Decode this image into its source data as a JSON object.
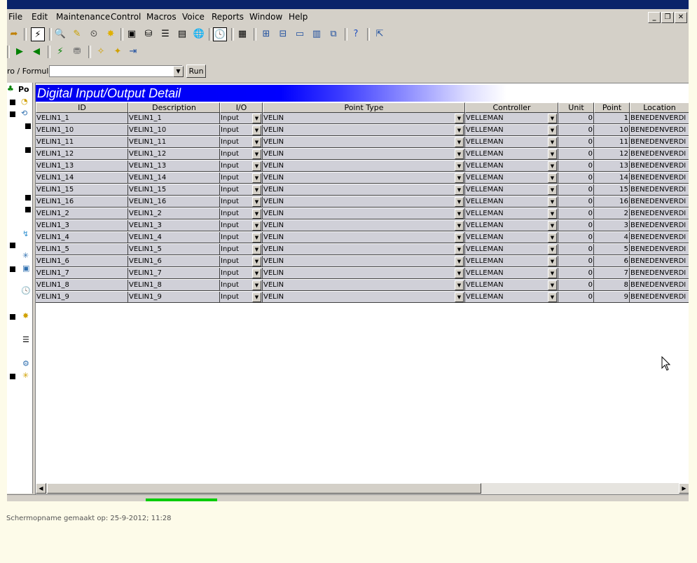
{
  "app": {
    "window_title": ""
  },
  "menu": [
    "File",
    "Edit",
    "Maintenance",
    "Control",
    "Macros",
    "Voice",
    "Reports",
    "Window",
    "Help"
  ],
  "macro": {
    "label": "ro / Formula:",
    "value": "",
    "run_label": "Run"
  },
  "tree": {
    "root_label": "Po"
  },
  "detail": {
    "title": "Digital Input/Output Detail"
  },
  "columns": [
    "ID",
    "Description",
    "I/O",
    "Point Type",
    "Controller",
    "Unit",
    "Point",
    "Location"
  ],
  "rows": [
    {
      "id": "VELIN1_1",
      "desc": "VELIN1_1",
      "io": "Input",
      "type": "VELIN",
      "ctrl": "VELLEMAN",
      "unit": "0",
      "point": "1",
      "loc": "BENEDENVERDI"
    },
    {
      "id": "VELIN1_10",
      "desc": "VELIN1_10",
      "io": "Input",
      "type": "VELIN",
      "ctrl": "VELLEMAN",
      "unit": "0",
      "point": "10",
      "loc": "BENEDENVERDI"
    },
    {
      "id": "VELIN1_11",
      "desc": "VELIN1_11",
      "io": "Input",
      "type": "VELIN",
      "ctrl": "VELLEMAN",
      "unit": "0",
      "point": "11",
      "loc": "BENEDENVERDI"
    },
    {
      "id": "VELIN1_12",
      "desc": "VELIN1_12",
      "io": "Input",
      "type": "VELIN",
      "ctrl": "VELLEMAN",
      "unit": "0",
      "point": "12",
      "loc": "BENEDENVERDI"
    },
    {
      "id": "VELIN1_13",
      "desc": "VELIN1_13",
      "io": "Input",
      "type": "VELIN",
      "ctrl": "VELLEMAN",
      "unit": "0",
      "point": "13",
      "loc": "BENEDENVERDI"
    },
    {
      "id": "VELIN1_14",
      "desc": "VELIN1_14",
      "io": "Input",
      "type": "VELIN",
      "ctrl": "VELLEMAN",
      "unit": "0",
      "point": "14",
      "loc": "BENEDENVERDI"
    },
    {
      "id": "VELIN1_15",
      "desc": "VELIN1_15",
      "io": "Input",
      "type": "VELIN",
      "ctrl": "VELLEMAN",
      "unit": "0",
      "point": "15",
      "loc": "BENEDENVERDI"
    },
    {
      "id": "VELIN1_16",
      "desc": "VELIN1_16",
      "io": "Input",
      "type": "VELIN",
      "ctrl": "VELLEMAN",
      "unit": "0",
      "point": "16",
      "loc": "BENEDENVERDI"
    },
    {
      "id": "VELIN1_2",
      "desc": "VELIN1_2",
      "io": "Input",
      "type": "VELIN",
      "ctrl": "VELLEMAN",
      "unit": "0",
      "point": "2",
      "loc": "BENEDENVERDI"
    },
    {
      "id": "VELIN1_3",
      "desc": "VELIN1_3",
      "io": "Input",
      "type": "VELIN",
      "ctrl": "VELLEMAN",
      "unit": "0",
      "point": "3",
      "loc": "BENEDENVERDI"
    },
    {
      "id": "VELIN1_4",
      "desc": "VELIN1_4",
      "io": "Input",
      "type": "VELIN",
      "ctrl": "VELLEMAN",
      "unit": "0",
      "point": "4",
      "loc": "BENEDENVERDI"
    },
    {
      "id": "VELIN1_5",
      "desc": "VELIN1_5",
      "io": "Input",
      "type": "VELIN",
      "ctrl": "VELLEMAN",
      "unit": "0",
      "point": "5",
      "loc": "BENEDENVERDI"
    },
    {
      "id": "VELIN1_6",
      "desc": "VELIN1_6",
      "io": "Input",
      "type": "VELIN",
      "ctrl": "VELLEMAN",
      "unit": "0",
      "point": "6",
      "loc": "BENEDENVERDI"
    },
    {
      "id": "VELIN1_7",
      "desc": "VELIN1_7",
      "io": "Input",
      "type": "VELIN",
      "ctrl": "VELLEMAN",
      "unit": "0",
      "point": "7",
      "loc": "BENEDENVERDI"
    },
    {
      "id": "VELIN1_8",
      "desc": "VELIN1_8",
      "io": "Input",
      "type": "VELIN",
      "ctrl": "VELLEMAN",
      "unit": "0",
      "point": "8",
      "loc": "BENEDENVERDI"
    },
    {
      "id": "VELIN1_9",
      "desc": "VELIN1_9",
      "io": "Input",
      "type": "VELIN",
      "ctrl": "VELLEMAN",
      "unit": "0",
      "point": "9",
      "loc": "BENEDENVERDI"
    }
  ],
  "caption": "Schermopname gemaakt op: 25-9-2012; 11:28",
  "colors": {
    "title_blue": "#0a246a",
    "banner_blue": "#0000ff",
    "chrome": "#d4d0c8",
    "page_bg": "#fdfbe9",
    "progress_green": "#00cc00"
  }
}
